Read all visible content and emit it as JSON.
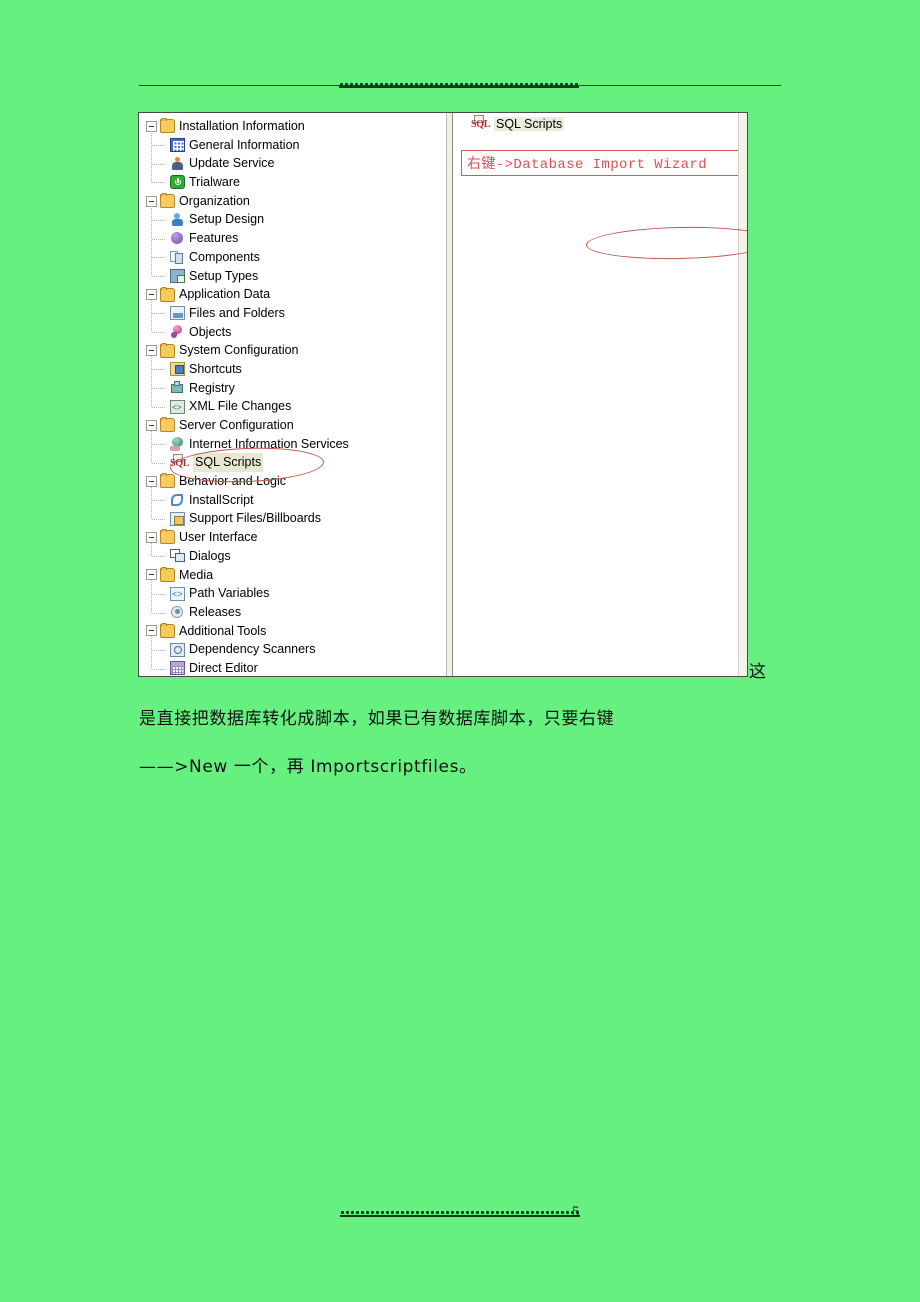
{
  "page": {
    "page_number": "5",
    "background_color": "#66f080",
    "annotation_color": "#c0534f"
  },
  "screenshot": {
    "tree": {
      "items": [
        {
          "label": "Installation Information",
          "icon": "folder-icon",
          "level": 0,
          "expanded": true
        },
        {
          "label": "General Information",
          "icon": "grid-icon",
          "level": 1
        },
        {
          "label": "Update Service",
          "icon": "person-icon",
          "level": 1
        },
        {
          "label": "Trialware",
          "icon": "power-icon",
          "level": 1
        },
        {
          "label": "Organization",
          "icon": "folder-icon",
          "level": 0,
          "expanded": true
        },
        {
          "label": "Setup Design",
          "icon": "figure-icon",
          "level": 1
        },
        {
          "label": "Features",
          "icon": "sphere-icon",
          "level": 1
        },
        {
          "label": "Components",
          "icon": "boxes-icon",
          "level": 1
        },
        {
          "label": "Setup Types",
          "icon": "setup-types-icon",
          "level": 1
        },
        {
          "label": "Application Data",
          "icon": "folder-icon",
          "level": 0,
          "expanded": true
        },
        {
          "label": "Files and Folders",
          "icon": "page-icon",
          "level": 1
        },
        {
          "label": "Objects",
          "icon": "object-icon",
          "level": 1
        },
        {
          "label": "System Configuration",
          "icon": "folder-icon",
          "level": 0,
          "expanded": true
        },
        {
          "label": "Shortcuts",
          "icon": "shortcut-icon",
          "level": 1
        },
        {
          "label": "Registry",
          "icon": "registry-icon",
          "level": 1
        },
        {
          "label": "XML File Changes",
          "icon": "xml-icon",
          "level": 1
        },
        {
          "label": "Server Configuration",
          "icon": "folder-icon",
          "level": 0,
          "expanded": true
        },
        {
          "label": "Internet Information Services",
          "icon": "globe-icon",
          "level": 1
        },
        {
          "label": "SQL Scripts",
          "icon": "sql-icon",
          "level": 1,
          "selected": true
        },
        {
          "label": "Behavior and Logic",
          "icon": "folder-icon",
          "level": 0,
          "expanded": true
        },
        {
          "label": "InstallScript",
          "icon": "script-icon",
          "level": 1
        },
        {
          "label": "Support Files/Billboards",
          "icon": "support-files-icon",
          "level": 1
        },
        {
          "label": "User Interface",
          "icon": "folder-icon",
          "level": 0,
          "expanded": true
        },
        {
          "label": "Dialogs",
          "icon": "dialog-icon",
          "level": 1
        },
        {
          "label": "Media",
          "icon": "folder-icon",
          "level": 0,
          "expanded": true
        },
        {
          "label": "Path Variables",
          "icon": "path-variables-icon",
          "level": 1
        },
        {
          "label": "Releases",
          "icon": "release-icon",
          "level": 1
        },
        {
          "label": "Additional Tools",
          "icon": "folder-icon",
          "level": 0,
          "expanded": true
        },
        {
          "label": "Dependency Scanners",
          "icon": "scanner-icon",
          "level": 1
        },
        {
          "label": "Direct Editor",
          "icon": "editor-icon",
          "level": 1
        }
      ]
    },
    "detail": {
      "header_label": "SQL Scripts",
      "header_icon": "sql-icon",
      "note_text": "右键->Database Import Wizard"
    }
  },
  "body_text": {
    "trailer": "这",
    "line1": "是直接把数据库转化成脚本，如果已有数据库脚本，只要右键",
    "line2": "——>New 一个，再 Importscriptfiles。"
  }
}
